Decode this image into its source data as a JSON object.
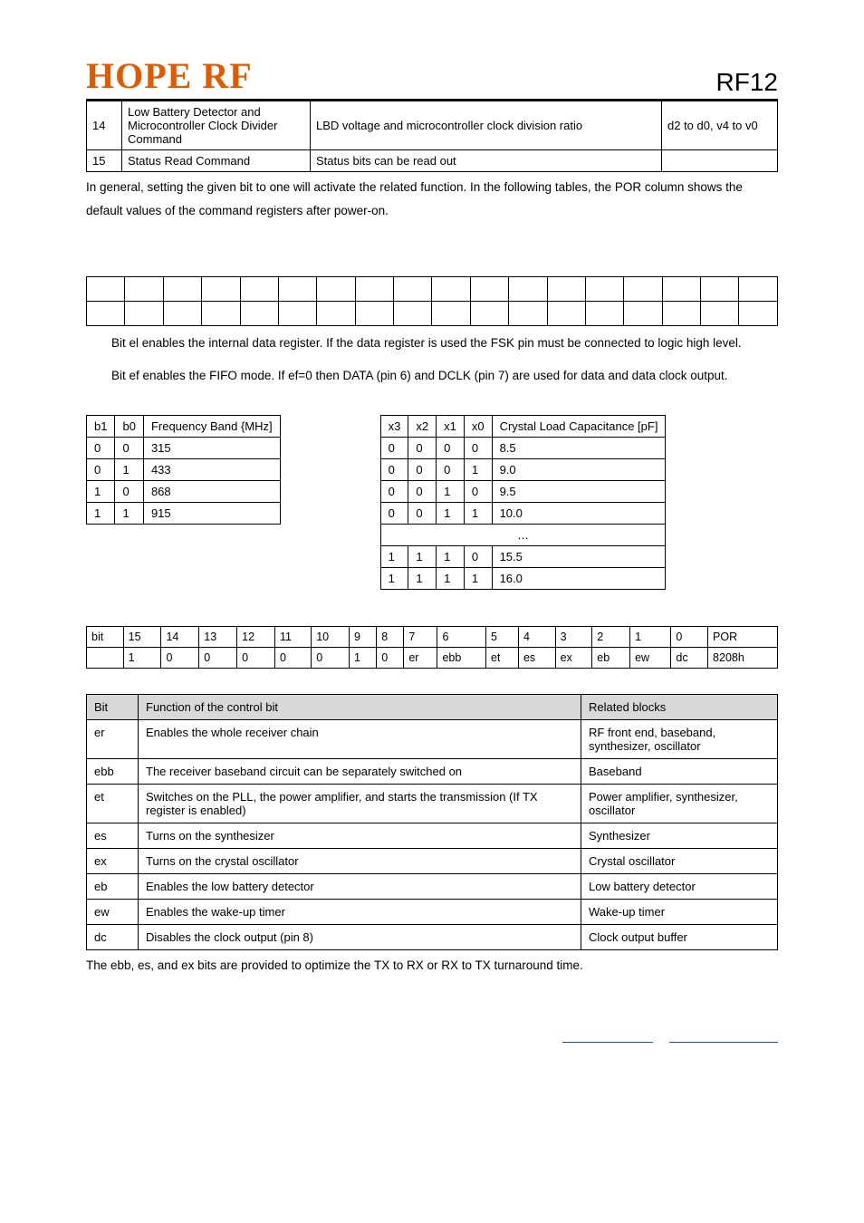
{
  "header": {
    "logo": "HOPE RF",
    "docid": "RF12"
  },
  "cmd_rows": [
    {
      "n": "14",
      "name": "Low Battery Detector and Microcontroller Clock Divider Command",
      "desc": "LBD voltage and microcontroller clock division ratio",
      "reg": "d2 to d0, v4 to v0"
    },
    {
      "n": "15",
      "name": "Status Read Command",
      "desc": "Status bits can be read out",
      "reg": ""
    }
  ],
  "para1": "In general, setting the given bit to one will activate the related function. In the following tables, the POR column shows the default values of the command registers after power-on.",
  "para2": "Bit el enables the internal data register. If the data register is used the FSK pin must be connected to logic high level.",
  "para3": "Bit ef enables the FIFO mode. If ef=0 then DATA (pin 6) and DCLK (pin 7) are used for data and data clock output.",
  "freq_head": {
    "c0": "b1",
    "c1": "b0",
    "c2": "Frequency Band {MHz]"
  },
  "freq_rows": [
    {
      "c0": "0",
      "c1": "0",
      "c2": "315"
    },
    {
      "c0": "0",
      "c1": "1",
      "c2": "433"
    },
    {
      "c0": "1",
      "c1": "0",
      "c2": "868"
    },
    {
      "c0": "1",
      "c1": "1",
      "c2": "915"
    }
  ],
  "cap_head": {
    "c0": "x3",
    "c1": "x2",
    "c2": "x1",
    "c3": "x0",
    "c4": "Crystal Load Capacitance [pF]"
  },
  "cap_rows_a": [
    {
      "c0": "0",
      "c1": "0",
      "c2": "0",
      "c3": "0",
      "c4": "8.5"
    },
    {
      "c0": "0",
      "c1": "0",
      "c2": "0",
      "c3": "1",
      "c4": "9.0"
    },
    {
      "c0": "0",
      "c1": "0",
      "c2": "1",
      "c3": "0",
      "c4": "9.5"
    },
    {
      "c0": "0",
      "c1": "0",
      "c2": "1",
      "c3": "1",
      "c4": "10.0"
    }
  ],
  "cap_ellipsis": "…",
  "cap_rows_b": [
    {
      "c0": "1",
      "c1": "1",
      "c2": "1",
      "c3": "0",
      "c4": "15.5"
    },
    {
      "c0": "1",
      "c1": "1",
      "c2": "1",
      "c3": "1",
      "c4": "16.0"
    }
  ],
  "bit_row0": [
    "bit",
    "15",
    "14",
    "13",
    "12",
    "11",
    "10",
    "9",
    "8",
    "7",
    "6",
    "5",
    "4",
    "3",
    "2",
    "1",
    "0",
    "POR"
  ],
  "bit_row1": [
    "",
    "1",
    "0",
    "0",
    "0",
    "0",
    "0",
    "1",
    "0",
    "er",
    "ebb",
    "et",
    "es",
    "ex",
    "eb",
    "ew",
    "dc",
    "8208h"
  ],
  "ctrl_head": {
    "c0": "Bit",
    "c1": "Function of the control bit",
    "c2": "Related blocks"
  },
  "ctrl_rows": [
    {
      "c0": "er",
      "c1": "Enables the whole receiver chain",
      "c2": "RF front end, baseband, synthesizer, oscillator"
    },
    {
      "c0": "ebb",
      "c1": "The receiver baseband circuit can be separately switched on",
      "c2": "Baseband"
    },
    {
      "c0": "et",
      "c1": "Switches on the PLL, the power amplifier, and starts the transmission (If TX register is enabled)",
      "c2": "Power amplifier, synthesizer, oscillator"
    },
    {
      "c0": "es",
      "c1": "Turns on the synthesizer",
      "c2": "Synthesizer"
    },
    {
      "c0": "ex",
      "c1": "Turns on the crystal oscillator",
      "c2": "Crystal oscillator"
    },
    {
      "c0": "eb",
      "c1": "Enables the low battery detector",
      "c2": "Low battery detector"
    },
    {
      "c0": "ew",
      "c1": "Enables the wake-up timer",
      "c2": "Wake-up timer"
    },
    {
      "c0": "dc",
      "c1": "Disables the clock output (pin 8)",
      "c2": "Clock output buffer"
    }
  ],
  "para4": "The ebb, es, and ex bits are provided to optimize the TX to RX or RX to TX turnaround time."
}
